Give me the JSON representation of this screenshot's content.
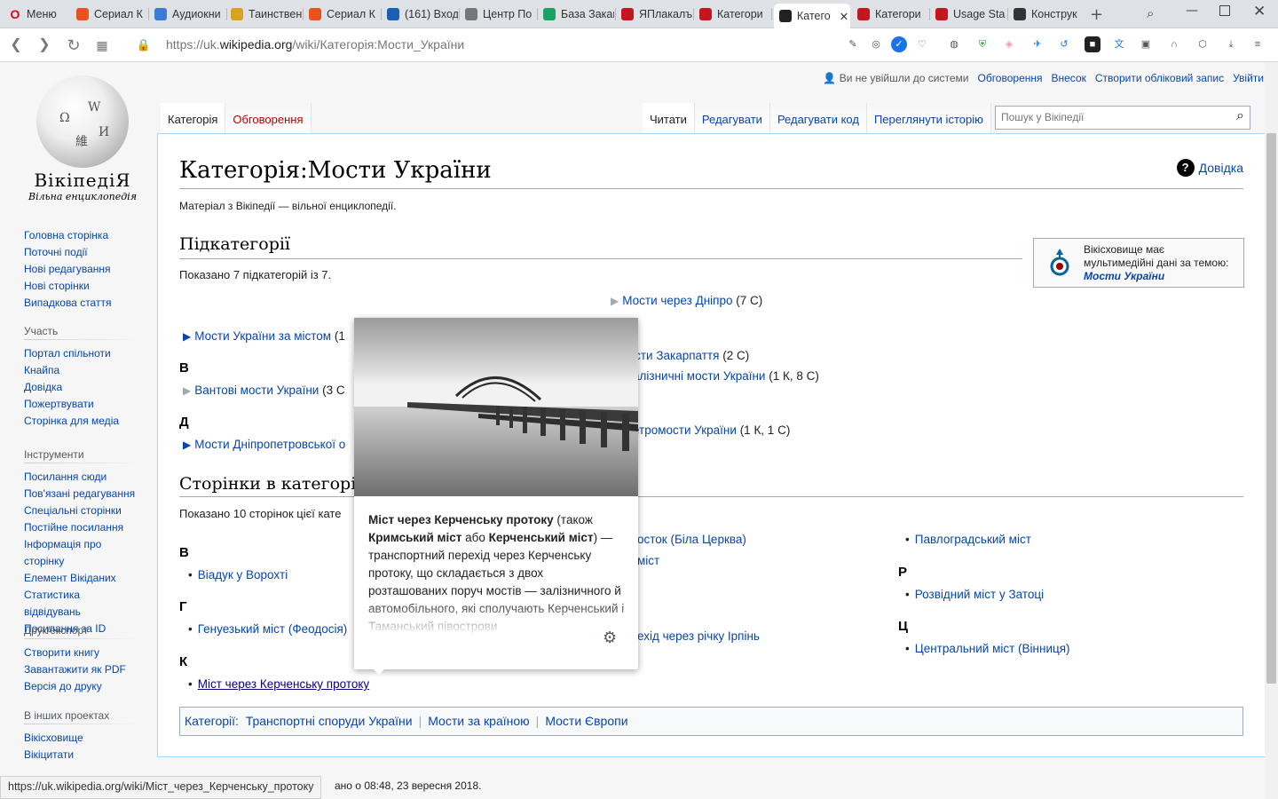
{
  "browser": {
    "menu_label": "Меню",
    "tabs": [
      {
        "label": "Сериал К",
        "color": "#e8521f"
      },
      {
        "label": "Аудиокни",
        "color": "#3a7bd5"
      },
      {
        "label": "Таинствен",
        "color": "#d7a21e"
      },
      {
        "label": "Сериал К",
        "color": "#e8521f"
      },
      {
        "label": "(161) Вход",
        "color": "#1a5fb4"
      },
      {
        "label": "Центр По",
        "color": "#777777"
      },
      {
        "label": "База Закаг",
        "color": "#1aa260"
      },
      {
        "label": "ЯПлакалъ",
        "color": "#c4161c"
      },
      {
        "label": "Категори",
        "color": "#c4161c"
      },
      {
        "label": "Катего",
        "color": "#222222",
        "active": true
      },
      {
        "label": "Категори",
        "color": "#c4161c"
      },
      {
        "label": "Usage Sta",
        "color": "#c4161c"
      },
      {
        "label": "Конструк",
        "color": "#333333"
      }
    ],
    "url_prefix": "https://uk.",
    "url_domain": "wikipedia.org",
    "url_path": "/wiki/Категорія:Мости_України",
    "status_url": "https://uk.wikipedia.org/wiki/Міст_через_Керченську_протоку"
  },
  "wiki": {
    "wordmark": "ВікіпедіЯ",
    "tagline": "Вільна енциклопедія",
    "nav": [
      "Головна сторінка",
      "Поточні події",
      "Нові редагування",
      "Нові сторінки",
      "Випадкова стаття"
    ],
    "participation": {
      "title": "Участь",
      "items": [
        "Портал спільноти",
        "Кнайпа",
        "Довідка",
        "Пожертвувати",
        "Сторінка для медіа"
      ]
    },
    "tools": {
      "title": "Інструменти",
      "items": [
        "Посилання сюди",
        "Пов'язані редагування",
        "Спеціальні сторінки",
        "Постійне посилання",
        "Інформація про сторінку",
        "Елемент Вікіданих",
        "Статистика відвідувань",
        "Посилання за ID"
      ]
    },
    "print": {
      "title": "Друк/експорт",
      "items": [
        "Створити книгу",
        "Завантажити як PDF",
        "Версія до друку"
      ]
    },
    "other": {
      "title": "В інших проектах",
      "items": [
        "Вікісховище",
        "Вікіцитати"
      ]
    },
    "personal": {
      "anon": "Ви не увійшли до системи",
      "talk": "Обговорення",
      "contrib": "Внесок",
      "create": "Створити обліковий запис",
      "login": "Увійти"
    },
    "tabs_left": [
      "Категорія",
      "Обговорення"
    ],
    "tabs_right": [
      "Читати",
      "Редагувати",
      "Редагувати код",
      "Переглянути історію"
    ],
    "search_placeholder": "Пошук у Вікіпедії"
  },
  "page": {
    "title": "Категорія:Мости України",
    "help": "Довідка",
    "siteSub": "Матеріал з Вікіпедії — вільної енциклопедії.",
    "subcat_heading": "Підкатегорії",
    "subcat_count": "Показано 7 підкатегорій із 7.",
    "subcats": {
      "dnipro": {
        "label": "Мости через Дніпро",
        "count": "(7 С)"
      },
      "city": {
        "label": "Мости України за містом",
        "count": "(1"
      },
      "letter_v": "В",
      "cable": {
        "label": "Вантові мости України",
        "count": "(3 С"
      },
      "letter_d": "Д",
      "dnipropetrovsk": {
        "label": "Мости Дніпропетровської о"
      },
      "zakarpattia": {
        "label": "юсти Закарпаття",
        "count": "(2 С)"
      },
      "rail": {
        "label": "алізничні мости України",
        "count": "(1 К, 8 С)"
      },
      "viaduct": {
        "label": "етромости України",
        "count": "(1 К, 1 С)"
      }
    },
    "pages_heading": "Сторінки в категорії",
    "pages_count": "Показано 10 сторінок цієї кате",
    "pages": {
      "letter_v": "В",
      "vorokhta": "Віадук у Ворохті",
      "letter_h": "Г",
      "genoese": "Генуезький міст (Феодосія)",
      "letter_k": "К",
      "kerch": "Міст через Керченську протоку",
      "bila": "осток (Біла Церква)",
      "mid2": "міст",
      "irpin": "ехід через річку Ірпінь",
      "pavlohrad": "Павлоградський міст",
      "letter_r": "Р",
      "zatoka": "Розвідний міст у Затоці",
      "letter_ts": "Ц",
      "vinnytsia": "Центральний міст (Вінниця)",
      "mid_letter": "П"
    },
    "commons": {
      "text": "Вікісховище має мультимедійні дані за темою:",
      "link": "Мости України"
    },
    "catlinks": {
      "label": "Категорії:",
      "items": [
        "Транспортні споруди України",
        "Мости за країною",
        "Мости Європи"
      ]
    },
    "footer": "ано о 08:48, 23 вересня 2018."
  },
  "popup": {
    "bold1": "Міст через Керченську протоку",
    "t1": " (також ",
    "bold2": "Кримський міст",
    "t2": " або ",
    "bold3": "Керченський міст",
    "t3": ") — транспортний перехід через Керченську протоку, що складається з двох розташованих поруч мостів — залізничного й автомобільного, які сполучають Керченський і Таманський півострови"
  },
  "colors": {
    "link": "#0645ad",
    "border": "#a7d7f9",
    "sidebar_bg": "#f6f6f6"
  }
}
